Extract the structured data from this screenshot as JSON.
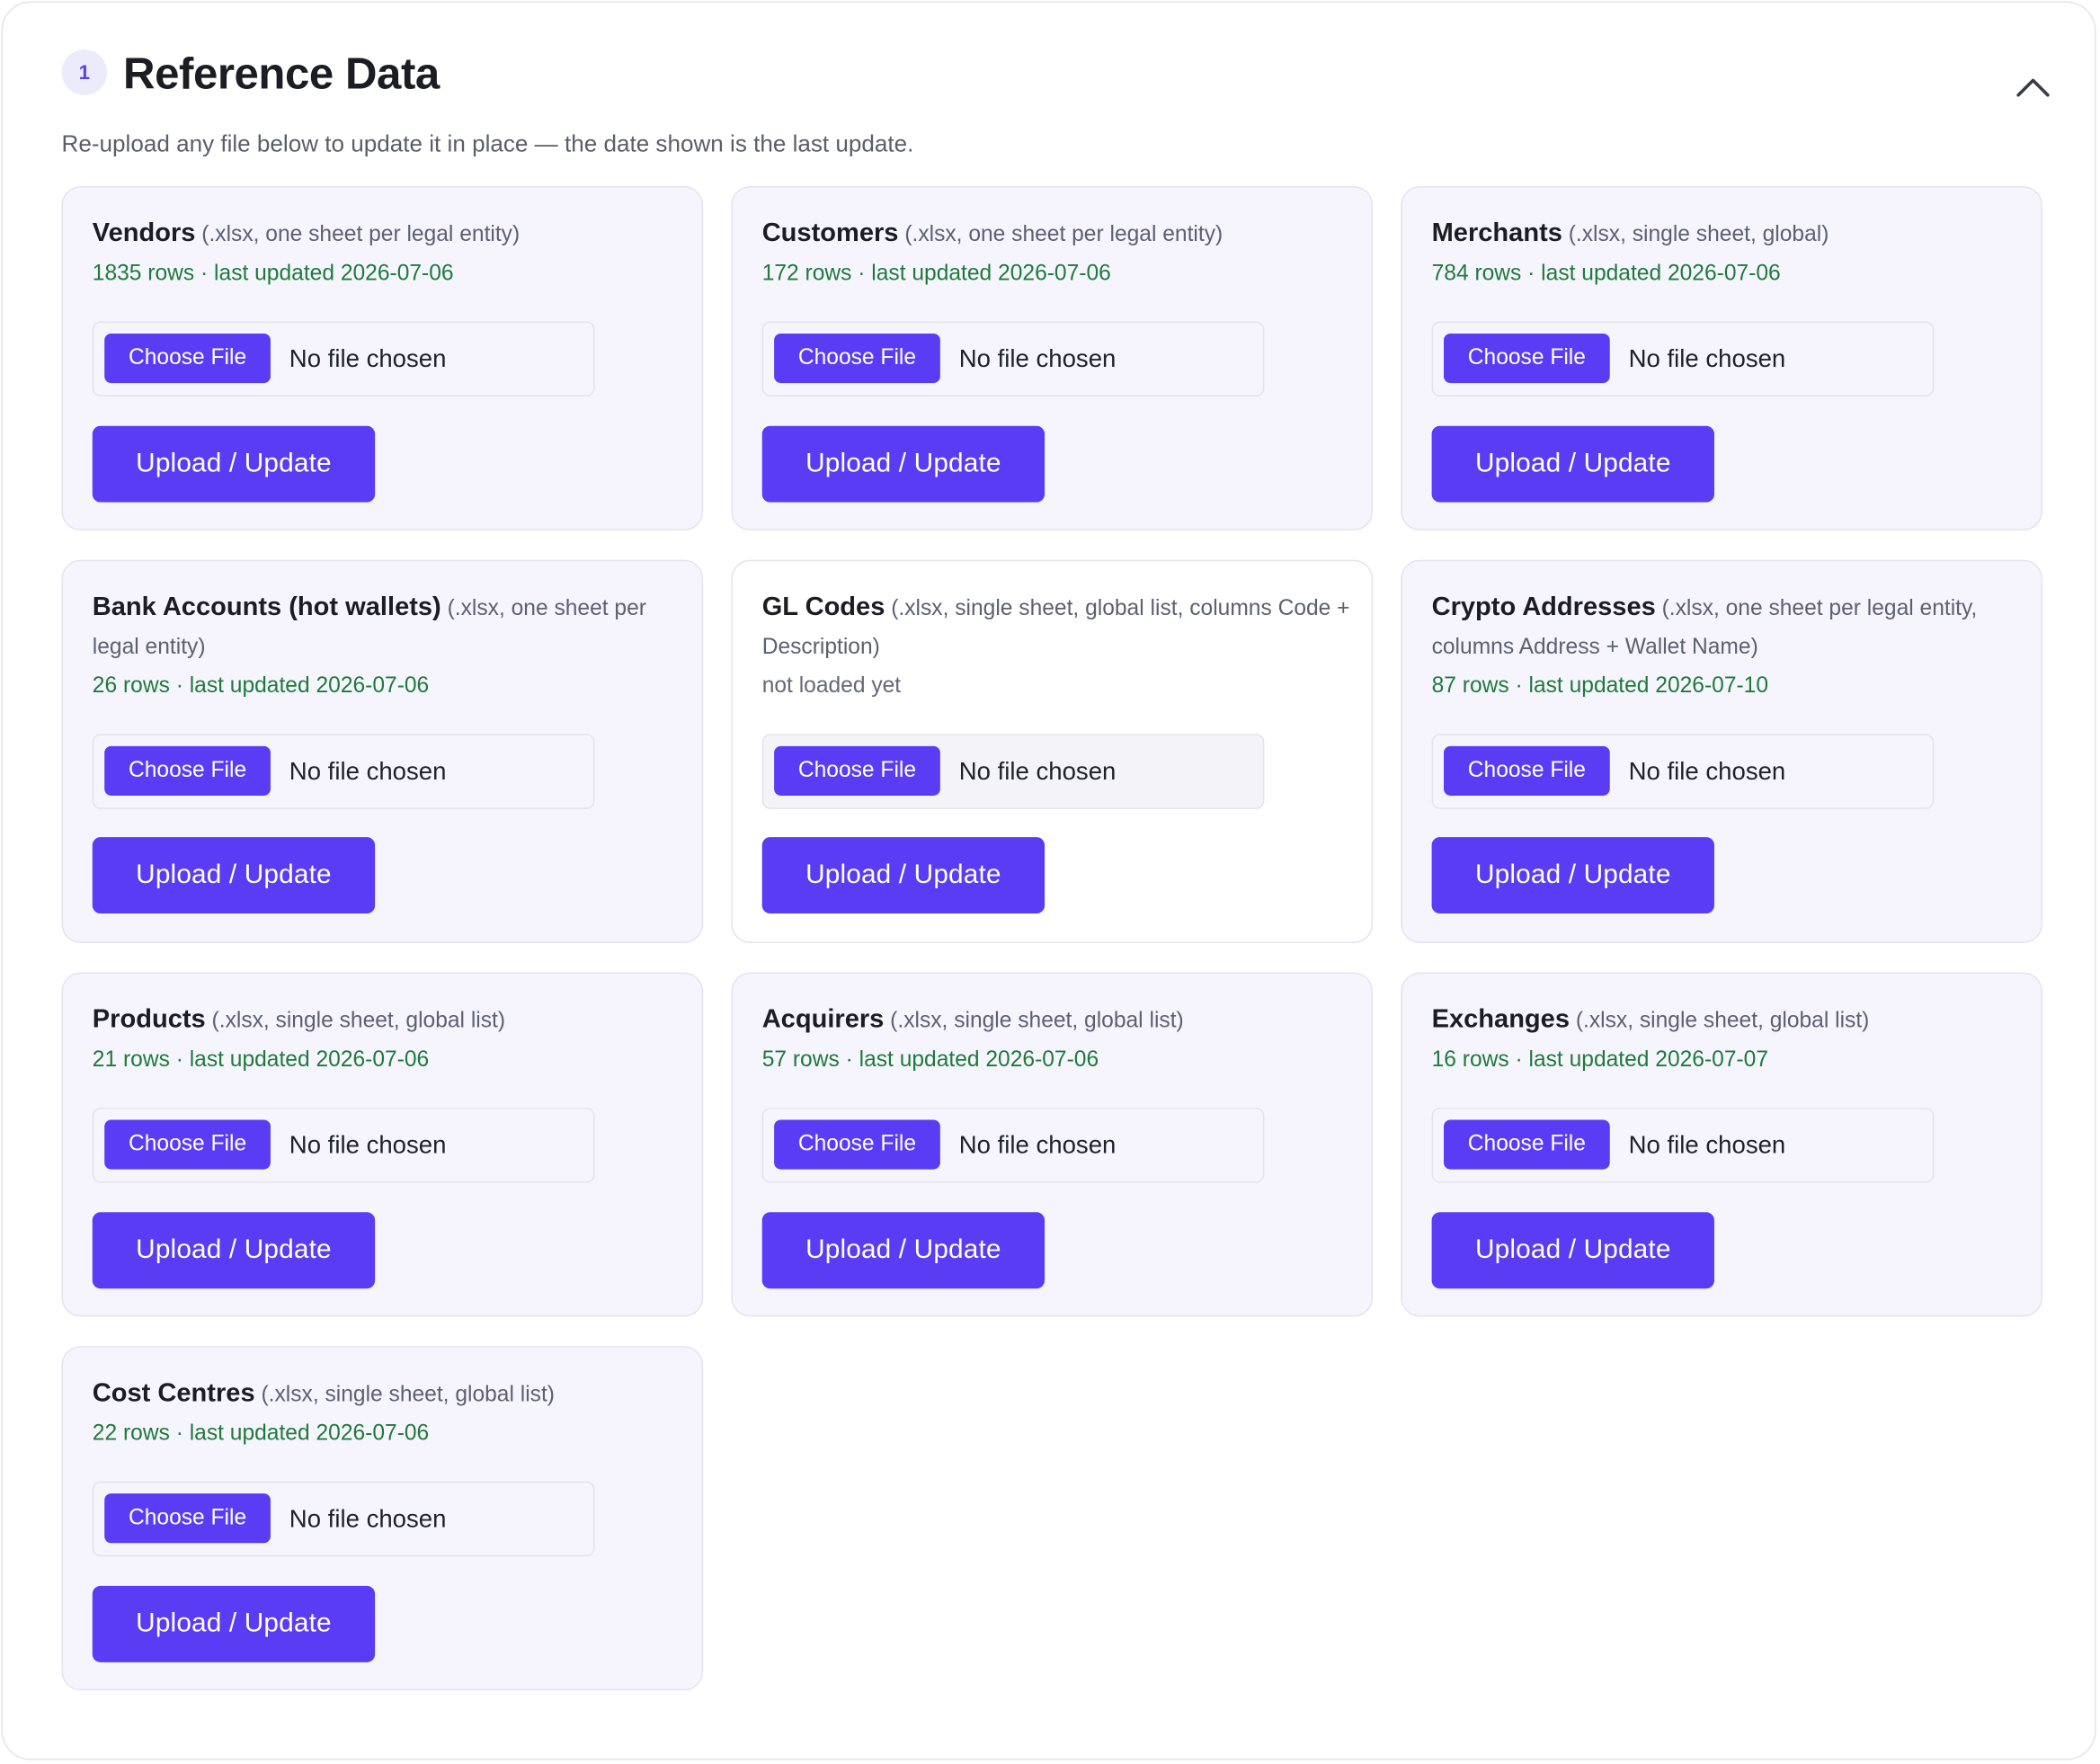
{
  "section": {
    "step_number": "1",
    "title": "Reference Data",
    "subtitle": "Re-upload any file below to update it in place — the date shown is the last update."
  },
  "controls": {
    "choose_file_label": "Choose File",
    "no_file_label": "No file chosen",
    "upload_label": "Upload / Update"
  },
  "cards": [
    {
      "title": "Vendors",
      "format": "(.xlsx, one sheet per legal entity)",
      "status": "1835 rows · last updated 2026-07-06"
    },
    {
      "title": "Customers",
      "format": "(.xlsx, one sheet per legal entity)",
      "status": "172 rows · last updated 2026-07-06"
    },
    {
      "title": "Merchants",
      "format": "(.xlsx, single sheet, global)",
      "status": "784 rows · last updated 2026-07-06"
    },
    {
      "title": "Bank Accounts (hot wallets)",
      "format": "(.xlsx, one sheet per legal entity)",
      "status": "26 rows · last updated 2026-07-06"
    },
    {
      "title": "GL Codes",
      "format": "(.xlsx, single sheet, global list, columns Code + Description)",
      "status": "not loaded yet"
    },
    {
      "title": "Crypto Addresses",
      "format": "(.xlsx, one sheet per legal entity, columns Address + Wallet Name)",
      "status": "87 rows · last updated 2026-07-10"
    },
    {
      "title": "Products",
      "format": "(.xlsx, single sheet, global list)",
      "status": "21 rows · last updated 2026-07-06"
    },
    {
      "title": "Acquirers",
      "format": "(.xlsx, single sheet, global list)",
      "status": "57 rows · last updated 2026-07-06"
    },
    {
      "title": "Exchanges",
      "format": "(.xlsx, single sheet, global list)",
      "status": "16 rows · last updated 2026-07-07"
    },
    {
      "title": "Cost Centres",
      "format": "(.xlsx, single sheet, global list)",
      "status": "22 rows · last updated 2026-07-06"
    }
  ],
  "icons": {
    "collapse": "chevron-up-icon"
  },
  "colors": {
    "accent": "#5b3cf5",
    "status_ok": "#1f7a3a",
    "status_pending": "#656875",
    "card_bg": "#f6f5fe"
  }
}
